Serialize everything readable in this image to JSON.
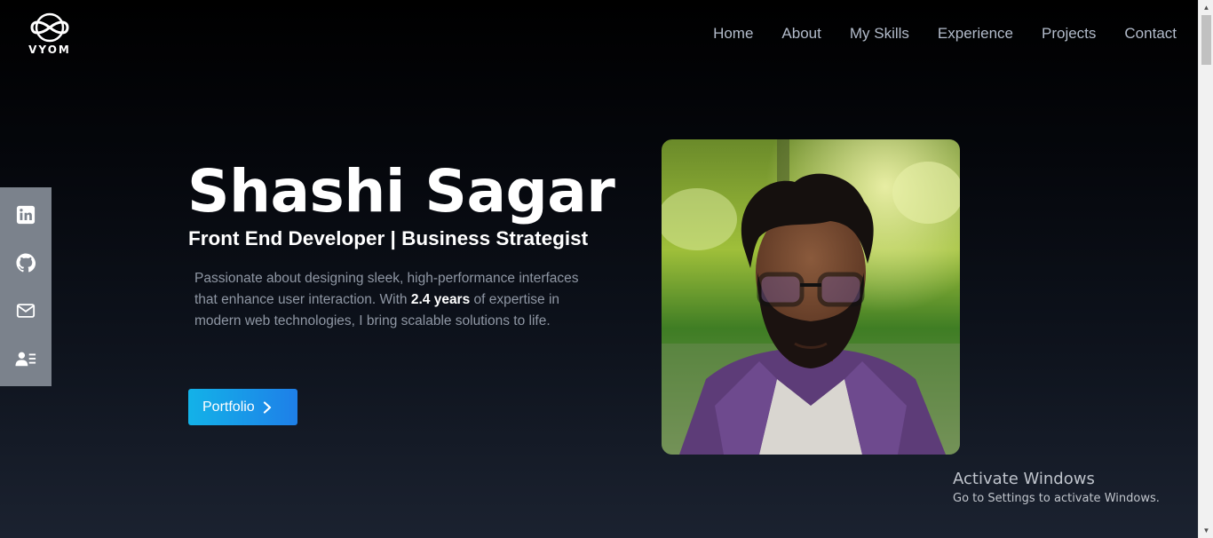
{
  "brand": {
    "logo_text": "VYOM",
    "logo_icon": "infinity-logo-icon"
  },
  "nav": {
    "items": [
      {
        "label": "Home"
      },
      {
        "label": "About"
      },
      {
        "label": "My Skills"
      },
      {
        "label": "Experience"
      },
      {
        "label": "Projects"
      },
      {
        "label": "Contact"
      }
    ]
  },
  "social": {
    "icons": [
      "linkedin-icon",
      "github-icon",
      "mail-icon",
      "contact-card-icon"
    ]
  },
  "hero": {
    "name": "Shashi Sagar",
    "role": "Front End Developer | Business Strategist",
    "desc_before": "Passionate about designing sleek, high-performance interfaces that enhance user interaction. With ",
    "desc_highlight": "2.4 years",
    "desc_after": " of expertise in modern web technologies, I bring scalable solutions to life.",
    "cta_label": "Portfolio"
  },
  "watermark": {
    "title": "Activate Windows",
    "subtitle": "Go to Settings to activate Windows."
  },
  "colors": {
    "accent_start": "#13b2e8",
    "accent_end": "#1e7fe8",
    "sidebar_bg": "#7b828c",
    "nav_text": "#b3bccb"
  }
}
